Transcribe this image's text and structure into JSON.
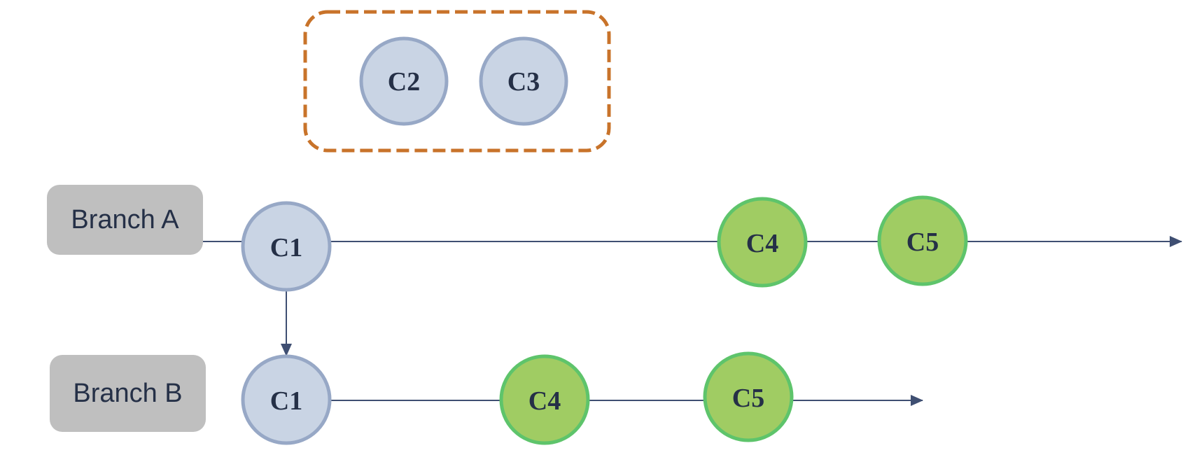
{
  "diagram": {
    "title": "",
    "colors": {
      "line": "#3f4f72",
      "commit_base_fill": "#c9d4e4",
      "commit_base_stroke": "#97a8c6",
      "commit_new_fill": "#a0cc63",
      "commit_new_stroke": "#5ec46b",
      "group_border": "#c8732a",
      "label_bg": "#bfbfbf",
      "text": "#253047"
    },
    "group": {
      "label": "",
      "commits": [
        "C2",
        "C3"
      ]
    },
    "branches": [
      {
        "label": "Branch A",
        "commits": [
          {
            "id": "C1",
            "kind": "base"
          },
          {
            "id": "C4",
            "kind": "new"
          },
          {
            "id": "C5",
            "kind": "new"
          }
        ]
      },
      {
        "label": "Branch B",
        "commits": [
          {
            "id": "C1",
            "kind": "base"
          },
          {
            "id": "C4",
            "kind": "new"
          },
          {
            "id": "C5",
            "kind": "new"
          }
        ]
      }
    ],
    "edges": [
      {
        "from": "Branch A.C1",
        "to": "Branch B.C1",
        "type": "arrow"
      }
    ]
  }
}
